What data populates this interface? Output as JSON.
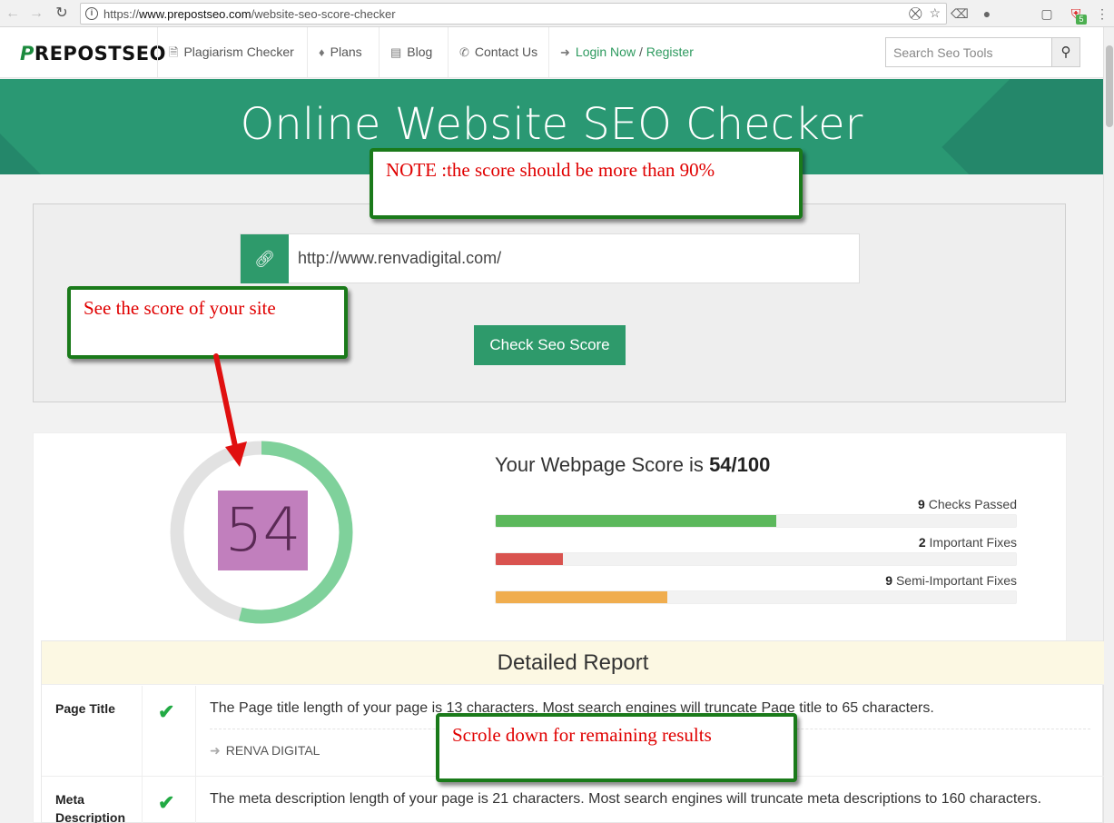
{
  "browser": {
    "url_prefix": "https://",
    "url_host": "www.prepostseo.com",
    "url_path": "/website-seo-score-checker",
    "extension_badge": "5"
  },
  "header": {
    "logo_p": "P",
    "logo_rest": "REPOSTSEO",
    "menu": [
      {
        "label": "Plagiarism Checker",
        "icon": "document-icon"
      },
      {
        "label": "Plans",
        "icon": "tag-icon"
      },
      {
        "label": "Blog",
        "icon": "newspaper-icon"
      },
      {
        "label": "Contact Us",
        "icon": "phone-icon"
      }
    ],
    "login_label": "Login Now",
    "separator": "/",
    "register_label": "Register",
    "search_placeholder": "Search Seo Tools"
  },
  "banner": {
    "title": "Online Website SEO Checker"
  },
  "checker": {
    "url_value": "http://www.renvadigital.com/",
    "check_button": "Check Seo Score"
  },
  "score": {
    "value": "54",
    "fraction": 0.54,
    "heading_prefix": "Your Webpage Score is",
    "heading_value": "54/100",
    "bars": [
      {
        "count": "9",
        "label": "Checks Passed",
        "fill": 0.54,
        "color": "#5cb85c"
      },
      {
        "count": "2",
        "label": "Important Fixes",
        "fill": 0.13,
        "color": "#d9534f"
      },
      {
        "count": "9",
        "label": "Semi-Important Fixes",
        "fill": 0.33,
        "color": "#f0ad4e"
      }
    ]
  },
  "report": {
    "title": "Detailed Report",
    "rows": [
      {
        "label": "Page Title",
        "text": "The Page title length of your page is 13 characters. Most search engines will truncate Page title to 65 characters.",
        "sub": "RENVA DIGITAL"
      },
      {
        "label": "Meta Description",
        "text": "The meta description length of your page is 21 characters. Most search engines will truncate meta descriptions to 160 characters."
      }
    ]
  },
  "annotations": {
    "note": "NOTE :the score should be more than 90%",
    "see_score": "See the score of your site",
    "scroll_down": "Scrole down for remaining results"
  },
  "colors": {
    "brand_green": "#2e9a6b",
    "banner": "#2a9873",
    "callout_border": "#1a7a1a",
    "callout_text": "#e00000"
  }
}
